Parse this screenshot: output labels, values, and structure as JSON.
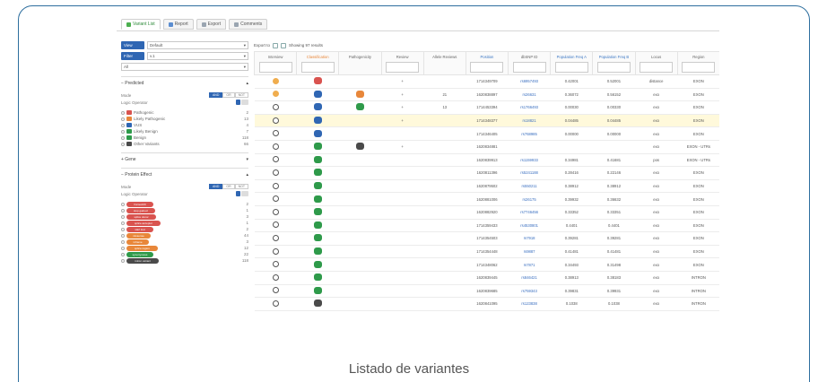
{
  "caption": "Listado de variantes",
  "colors": {
    "frame": "#2d6e9e",
    "primary": "#2f66b3",
    "green": "#2e9a4a",
    "orange": "#e8873a",
    "red": "#d9534f",
    "dark": "#4a4a4a"
  },
  "tabs": [
    {
      "label": "Variant List",
      "icon": "list-icon"
    },
    {
      "label": "Report",
      "icon": "report-icon"
    },
    {
      "label": "Export",
      "icon": "export-icon"
    },
    {
      "label": "Comments",
      "icon": "comment-icon"
    }
  ],
  "sidebar": {
    "view_button": "View",
    "view_value": "Default",
    "filter_button": "Filter",
    "filter_value": "v.1",
    "third_select": "All",
    "sections": [
      {
        "title": "Predicted",
        "mode_label": "Mode",
        "modes": [
          "AND",
          "OR",
          "NOT"
        ],
        "logic_label": "Logic Operator",
        "items": [
          {
            "label": "Pathogenic",
            "count": "2",
            "color": "#d9534f"
          },
          {
            "label": "Likely Pathogenic",
            "count": "13",
            "color": "#e8873a"
          },
          {
            "label": "VUS",
            "count": "4",
            "color": "#2f66b3"
          },
          {
            "label": "Likely Benign",
            "count": "7",
            "color": "#2e9a4a"
          },
          {
            "label": "Benign",
            "count": "118",
            "color": "#2e9a4a"
          },
          {
            "label": "Other Variants",
            "count": "66",
            "color": "#4a4a4a"
          }
        ]
      },
      {
        "title": "Gene",
        "collapsed": true
      },
      {
        "title": "Protein Effect",
        "mode_label": "Mode",
        "modes": [
          "AND",
          "OR",
          "NOT"
        ],
        "logic_label": "Logic Operator",
        "items": [
          {
            "label": "frameshift",
            "count": "2",
            "color": "#d9534f"
          },
          {
            "label": "stop gained",
            "count": "1",
            "color": "#d9534f"
          },
          {
            "label": "splice donor",
            "count": "3",
            "color": "#d9534f"
          },
          {
            "label": "splice acceptor",
            "count": "1",
            "color": "#d9534f"
          },
          {
            "label": "start lost",
            "count": "2",
            "color": "#d9534f"
          },
          {
            "label": "missense",
            "count": "44",
            "color": "#e8873a"
          },
          {
            "label": "inframe",
            "count": "3",
            "color": "#e8873a"
          },
          {
            "label": "splice region",
            "count": "12",
            "color": "#e8873a"
          },
          {
            "label": "synonymous",
            "count": "22",
            "color": "#2e9a4a"
          },
          {
            "label": "intron variant",
            "count": "118",
            "color": "#4a4a4a"
          }
        ]
      }
    ]
  },
  "main": {
    "export_label": "Export to",
    "showing_text": "Showing 97 results",
    "headers": [
      "Interview",
      "Classification",
      "Pathogenicity",
      "Review",
      "Allele Reviews",
      "Position",
      "dbSNP ID",
      "Population Freq A",
      "Population Freq B",
      "Locus",
      "Region"
    ],
    "rows": [
      {
        "status": "warn",
        "cls": "red",
        "path": null,
        "rev": "+",
        "ar": "",
        "pos": "1714349709",
        "id": "rs6957493",
        "fa": "0.42001",
        "fb": "0.52001",
        "locus": "distance",
        "region": "EXON",
        "hl": false
      },
      {
        "status": "warn",
        "cls": "blue",
        "path": "orange",
        "rev": "+",
        "ar": "21",
        "pos": "1620838897",
        "id": "rs26631",
        "fa": "0.36072",
        "fb": "0.56152",
        "locus": "exo",
        "region": "EXON",
        "hl": false
      },
      {
        "status": "ok",
        "cls": "blue",
        "path": "green",
        "rev": "+",
        "ar": "13",
        "pos": "1714453394",
        "id": "rs1766493",
        "fa": "0.00030",
        "fb": "0.00330",
        "locus": "exo",
        "region": "EXON",
        "hl": false
      },
      {
        "status": "ok",
        "cls": "blue",
        "path": null,
        "rev": "+",
        "ar": "",
        "pos": "1714348377",
        "id": "rs18821",
        "fa": "0.04485",
        "fb": "0.04485",
        "locus": "exo",
        "region": "EXON",
        "hl": true
      },
      {
        "status": "ok",
        "cls": "blue",
        "path": null,
        "rev": "",
        "ar": "",
        "pos": "1714346405",
        "id": "rs768985",
        "fa": "0.00000",
        "fb": "0.00000",
        "locus": "exo",
        "region": "EXON",
        "hl": false
      },
      {
        "status": "ok",
        "cls": "green",
        "path": "dark",
        "rev": "+",
        "ar": "",
        "pos": "1620834881",
        "id": "",
        "fa": "",
        "fb": "",
        "locus": "exo",
        "region": "EXON - UTRs",
        "hl": false
      },
      {
        "status": "ok",
        "cls": "green",
        "path": null,
        "rev": "",
        "ar": "",
        "pos": "1620839913",
        "id": "rs1159933",
        "fa": "0.34981",
        "fb": "0.41681",
        "locus": "pos",
        "region": "EXON - UTRs",
        "hl": false
      },
      {
        "status": "ok",
        "cls": "green",
        "path": null,
        "rev": "",
        "ar": "",
        "pos": "1620811396",
        "id": "rs5241188",
        "fa": "0.28416",
        "fb": "0.22146",
        "locus": "exo",
        "region": "EXON",
        "hl": false
      },
      {
        "status": "ok",
        "cls": "green",
        "path": null,
        "rev": "",
        "ar": "",
        "pos": "1620879502",
        "id": "rs550211",
        "fa": "0.38912",
        "fb": "0.38912",
        "locus": "exo",
        "region": "EXON",
        "hl": false
      },
      {
        "status": "ok",
        "cls": "green",
        "path": null,
        "rev": "",
        "ar": "",
        "pos": "1620881006",
        "id": "rs26175",
        "fa": "0.39932",
        "fb": "0.36632",
        "locus": "exo",
        "region": "EXON",
        "hl": false
      },
      {
        "status": "ok",
        "cls": "green",
        "path": null,
        "rev": "",
        "ar": "",
        "pos": "1620882920",
        "id": "rs7746456",
        "fa": "0.33352",
        "fb": "0.33351",
        "locus": "exo",
        "region": "EXON",
        "hl": false
      },
      {
        "status": "ok",
        "cls": "green",
        "path": null,
        "rev": "",
        "ar": "",
        "pos": "1714359433",
        "id": "rs4530801",
        "fa": "0.4401",
        "fb": "0.4401",
        "locus": "exo",
        "region": "EXON",
        "hl": false
      },
      {
        "status": "ok",
        "cls": "green",
        "path": null,
        "rev": "",
        "ar": "",
        "pos": "1714354503",
        "id": "rs7918",
        "fa": "0.39281",
        "fb": "0.39281",
        "locus": "exo",
        "region": "EXON",
        "hl": false
      },
      {
        "status": "ok",
        "cls": "green",
        "path": null,
        "rev": "",
        "ar": "",
        "pos": "1714354448",
        "id": "rs9887",
        "fa": "0.41481",
        "fb": "0.41481",
        "locus": "exo",
        "region": "EXON",
        "hl": false
      },
      {
        "status": "ok",
        "cls": "green",
        "path": null,
        "rev": "",
        "ar": "",
        "pos": "1714348062",
        "id": "rs7871",
        "fa": "0.34493",
        "fb": "0.31498",
        "locus": "exo",
        "region": "EXON",
        "hl": false
      },
      {
        "status": "ok",
        "cls": "green",
        "path": null,
        "rev": "",
        "ar": "",
        "pos": "1620839445",
        "id": "rs846421",
        "fa": "0.38913",
        "fb": "0.38183",
        "locus": "exo",
        "region": "INTRON",
        "hl": false
      },
      {
        "status": "ok",
        "cls": "green",
        "path": null,
        "rev": "",
        "ar": "",
        "pos": "1620839685",
        "id": "rs759343",
        "fa": "0.39831",
        "fb": "0.39931",
        "locus": "exo",
        "region": "INTRON",
        "hl": false
      },
      {
        "status": "ok",
        "cls": "dark",
        "path": null,
        "rev": "",
        "ar": "",
        "pos": "1620841095",
        "id": "rs123838",
        "fa": "0.1038",
        "fb": "0.1038",
        "locus": "exo",
        "region": "INTRON",
        "hl": false
      }
    ]
  }
}
